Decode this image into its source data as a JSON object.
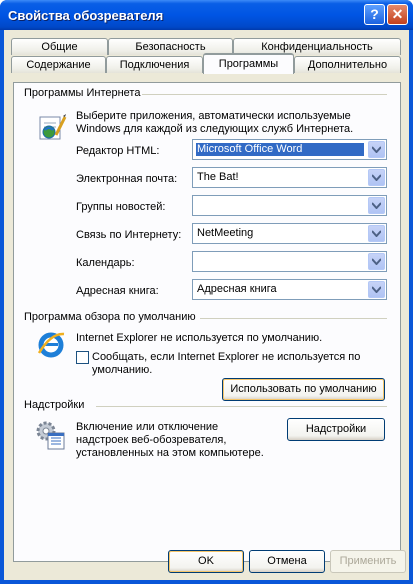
{
  "window": {
    "title": "Свойства обозревателя",
    "help_label": "?",
    "close_label": "✕"
  },
  "tabs": {
    "row1": [
      "Общие",
      "Безопасность",
      "Конфиденциальность"
    ],
    "row2": [
      "Содержание",
      "Подключения",
      "Программы",
      "Дополнительно"
    ],
    "active": "Программы"
  },
  "internet_programs": {
    "group_title": "Программы Интернета",
    "description": [
      "Выберите приложения, автоматически используемые",
      "Windows для каждой из следующих служб Интернета."
    ],
    "rows": [
      {
        "label": "Редактор HTML:",
        "value": "Microsoft Office Word",
        "selected": true
      },
      {
        "label": "Электронная почта:",
        "value": "The Bat!",
        "selected": false
      },
      {
        "label": "Группы новостей:",
        "value": "",
        "selected": false
      },
      {
        "label": "Связь по Интернету:",
        "value": "NetMeeting",
        "selected": false
      },
      {
        "label": "Календарь:",
        "value": "",
        "selected": false
      },
      {
        "label": "Адресная книга:",
        "value": "Адресная книга",
        "selected": false
      }
    ]
  },
  "default_browser": {
    "group_title": "Программа обзора по умолчанию",
    "status": "Internet Explorer не используется по умолчанию.",
    "checkbox_label": [
      "Сообщать, если Internet Explorer не используется по",
      "умолчанию."
    ],
    "checkbox_checked": false,
    "make_default_button": "Использовать по умолчанию"
  },
  "addons": {
    "group_title": "Надстройки",
    "description": [
      "Включение или отключение",
      "надстроек веб-обозревателя,",
      "установленных на этом компьютере."
    ],
    "button": "Надстройки"
  },
  "footer": {
    "ok": "OK",
    "cancel": "Отмена",
    "apply": "Применить"
  },
  "colors": {
    "titlebar": "#0055e4",
    "dialog_bg": "#ece9d8",
    "active_tab_accent": "#f7a52a",
    "selection": "#316ac5"
  }
}
